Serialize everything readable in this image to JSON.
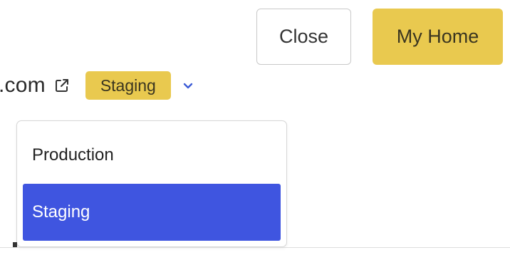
{
  "header": {
    "close_label": "Close",
    "home_label": "My Home"
  },
  "environment": {
    "domain_text": ".com",
    "selected_label": "Staging"
  },
  "menu": {
    "items": [
      {
        "label": "Production",
        "selected": false
      },
      {
        "label": "Staging",
        "selected": true
      }
    ]
  },
  "colors": {
    "accent_yellow": "#e9c94f",
    "selection_blue": "#3f55e0",
    "chevron_blue": "#3b5bd6"
  },
  "icons": {
    "external_link": "external-link-icon",
    "dropdown": "chevron-down-icon"
  }
}
